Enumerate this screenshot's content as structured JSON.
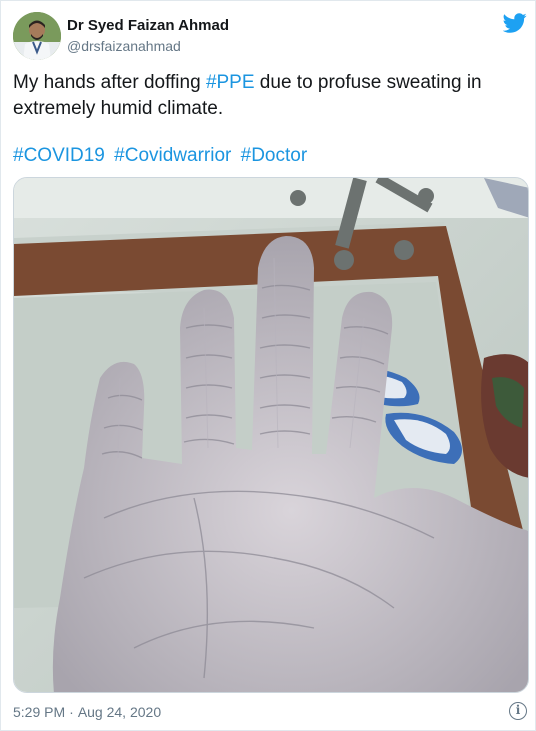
{
  "author": {
    "display_name": "Dr Syed Faizan Ahmad",
    "handle": "@drsfaizanahmad"
  },
  "tweet": {
    "text_before": "My hands after doffing ",
    "text_tag": "#PPE",
    "text_after": " due to profuse sweating in extremely humid climate.",
    "hashtags": [
      "#COVID19",
      "#Covidwarrior",
      "#Doctor"
    ]
  },
  "meta": {
    "time": "5:29 PM",
    "separator": "·",
    "date": "Aug 24, 2020"
  },
  "icons": {
    "brand": "twitter-bird-icon",
    "info": "info-icon"
  },
  "colors": {
    "link": "#1b95e0",
    "secondary_text": "#657786",
    "twitter_blue": "#1da1f2"
  }
}
